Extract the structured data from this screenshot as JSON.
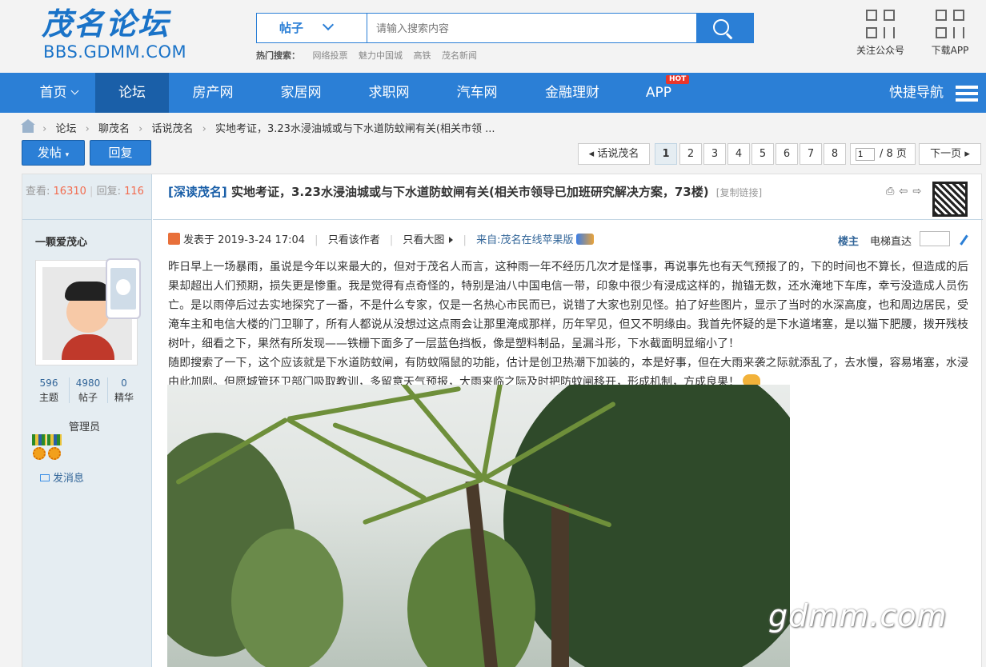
{
  "header": {
    "logo_cn": "茂名论坛",
    "logo_en": "BBS.GDMM.COM",
    "search": {
      "category": "帖子",
      "placeholder": "请输入搜索内容"
    },
    "hot_search_label": "热门搜索：",
    "hot_keywords": [
      "网络投票",
      "魅力中国城",
      "高铁",
      "茂名新闻"
    ],
    "follow_label": "关注公众号",
    "download_label": "下载APP"
  },
  "nav": {
    "items": [
      "首页",
      "论坛",
      "房产网",
      "家居网",
      "求职网",
      "汽车网",
      "金融理财",
      "APP"
    ],
    "active": "论坛",
    "hot_badge": "HOT",
    "quick_nav": "快捷导航"
  },
  "breadcrumb": [
    "论坛",
    "聊茂名",
    "话说茂名",
    "实地考证，3.23水浸油城或与下水道防蚊闸有关(相关市领 ..."
  ],
  "actions": {
    "post_label": "发帖",
    "reply_label": "回复"
  },
  "pager": {
    "prev_label": "话说茂名",
    "pages": [
      "1",
      "2",
      "3",
      "4",
      "5",
      "6",
      "7",
      "8"
    ],
    "current": "1",
    "input_value": "1",
    "total_label": "/ 8 页",
    "next_label": "下一页"
  },
  "thread": {
    "views_label": "查看:",
    "views": "16310",
    "replies_label": "回复:",
    "replies": "116",
    "tag": "[深读茂名]",
    "title": "实地考证，3.23水浸油城或与下水道防蚊闸有关(相关市领导已加班研究解决方案，73楼)",
    "copy_link": "[复制链接]"
  },
  "author": {
    "name": "一颗爱茂心",
    "stats": [
      {
        "value": "596",
        "label": "主题"
      },
      {
        "value": "4980",
        "label": "帖子"
      },
      {
        "value": "0",
        "label": "精华"
      }
    ],
    "role": "管理员",
    "send_msg": "发消息"
  },
  "post": {
    "posted_at": "发表于 2019-3-24 17:04",
    "only_author": "只看该作者",
    "only_big_image": "只看大图",
    "source": "来自:茂名在线苹果版",
    "floor_label": "楼主",
    "jump_label": "电梯直达",
    "paragraph1": "昨日早上一场暴雨，虽说是今年以来最大的，但对于茂名人而言，这种雨一年不经历几次才是怪事，再说事先也有天气预报了的，下的时间也不算长，但造成的后果却超出人们预期，损失更是惨重。我是觉得有点奇怪的，特别是油八中国电信一带，印象中很少有浸成这样的，抛锚无数，还水淹地下车库，幸亏没造成人员伤亡。是以雨停后过去实地探究了一番，不是什么专家，仅是一名热心市民而已，说错了大家也别见怪。拍了好些图片，显示了当时的水深高度，也和周边居民，受淹车主和电信大楼的门卫聊了，所有人都说从没想过这点雨会让那里淹成那样，历年罕见，但又不明缘由。我首先怀疑的是下水道堵塞，是以猫下肥腰，拨开残枝树叶，细看之下，果然有所发现——铁栅下面多了一层蓝色挡板，像是塑料制品，呈漏斗形，下水截面明显缩小了！",
    "paragraph2": "随即搜索了一下，这个应该就是下水道防蚊闸，有防蚊隔鼠的功能，估计是创卫热潮下加装的，本是好事，但在大雨来袭之际就添乱了，去水慢，容易堵塞，水浸由此加剧。但愿城管环卫部门吸取教训，多留意天气预报，大雨来临之际及时把防蚊闸移开，形成机制，方成良果！"
  },
  "watermark": "gdmm.com",
  "colors": {
    "brand_blue": "#2b7fd6",
    "nav_active": "#1a5fa8",
    "count_red": "#f26c4f",
    "side_bg": "#e5edf2"
  }
}
